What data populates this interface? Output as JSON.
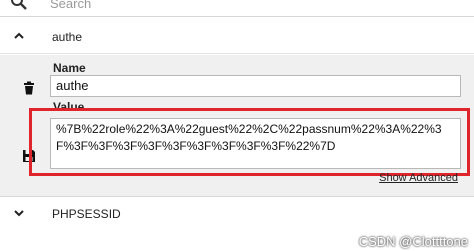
{
  "search": {
    "placeholder": "Search"
  },
  "cookies": [
    {
      "name": "authe",
      "expanded": true,
      "fields": {
        "name_label": "Name",
        "name_value": "authe",
        "value_label": "Value",
        "value_value": "%7B%22role%22%3A%22guest%22%2C%22passnum%22%3A%22%3F%3F%3F%3F%3F%3F%3F%3F%3F%3F%22%7D"
      },
      "advanced_link": "Show Advanced"
    },
    {
      "name": "PHPSESSID",
      "expanded": false
    }
  ],
  "icons": {
    "search": "search-icon",
    "collapse": "chevron-up-icon",
    "expand": "chevron-down-icon",
    "delete": "trash-icon",
    "save": "save-icon"
  },
  "colors": {
    "highlight": "#e0242b",
    "panel": "#f0f0f0"
  },
  "watermark": "CSDN @Clottttone"
}
